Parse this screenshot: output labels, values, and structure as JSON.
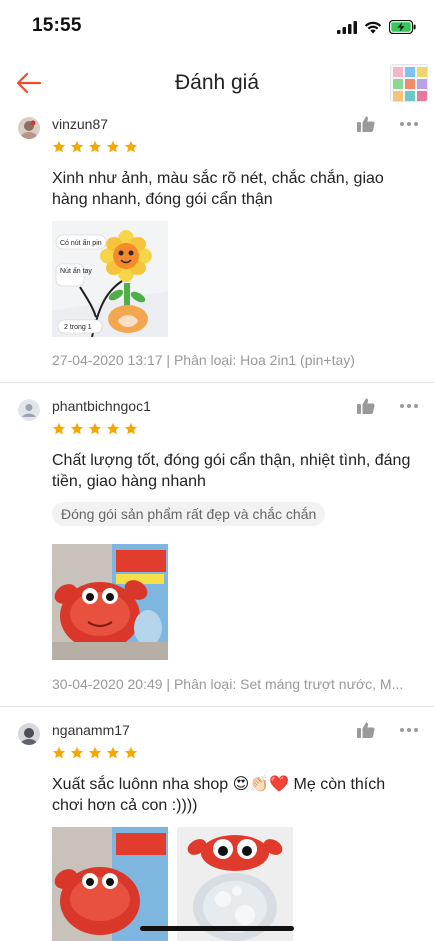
{
  "status_bar": {
    "time": "15:55",
    "battery_color": "#34c759"
  },
  "header": {
    "title": "Đánh giá",
    "accent_color": "#ee4d2d"
  },
  "reviews": [
    {
      "username": "vinzun87",
      "rating": 5,
      "text": "Xinh như ảnh, màu sắc rõ nét, chắc chắn, giao hàng nhanh, đóng gói cẩn thận",
      "photo_labels": [
        "Có nút ấn pin",
        "Nút ấn tay",
        "2 trong 1"
      ],
      "meta": "27-04-2020 13:17 | Phân loại: Hoa 2in1 (pin+tay)"
    },
    {
      "username": "phantbichngoc1",
      "rating": 5,
      "text": "Chất lượng tốt, đóng gói cẩn thận, nhiệt tình, đáng tiền, giao hàng nhanh",
      "tag": "Đóng gói sản phẩm rất đẹp và chắc chắn",
      "meta": "30-04-2020 20:49 | Phân loại: Set máng trượt nước, M..."
    },
    {
      "username": "nganamm17",
      "rating": 5,
      "text": "Xuất sắc luônn nha shop 😍👏🏻❤️ Mẹ còn thích chơi hơn cả con :))))"
    }
  ],
  "star_color": "#f6a700",
  "icons": {
    "back": "arrow-left-icon",
    "like": "thumbs-up-icon",
    "more": "more-dots-icon",
    "star": "star-icon",
    "avatar_default": "user-silhouette-icon"
  }
}
